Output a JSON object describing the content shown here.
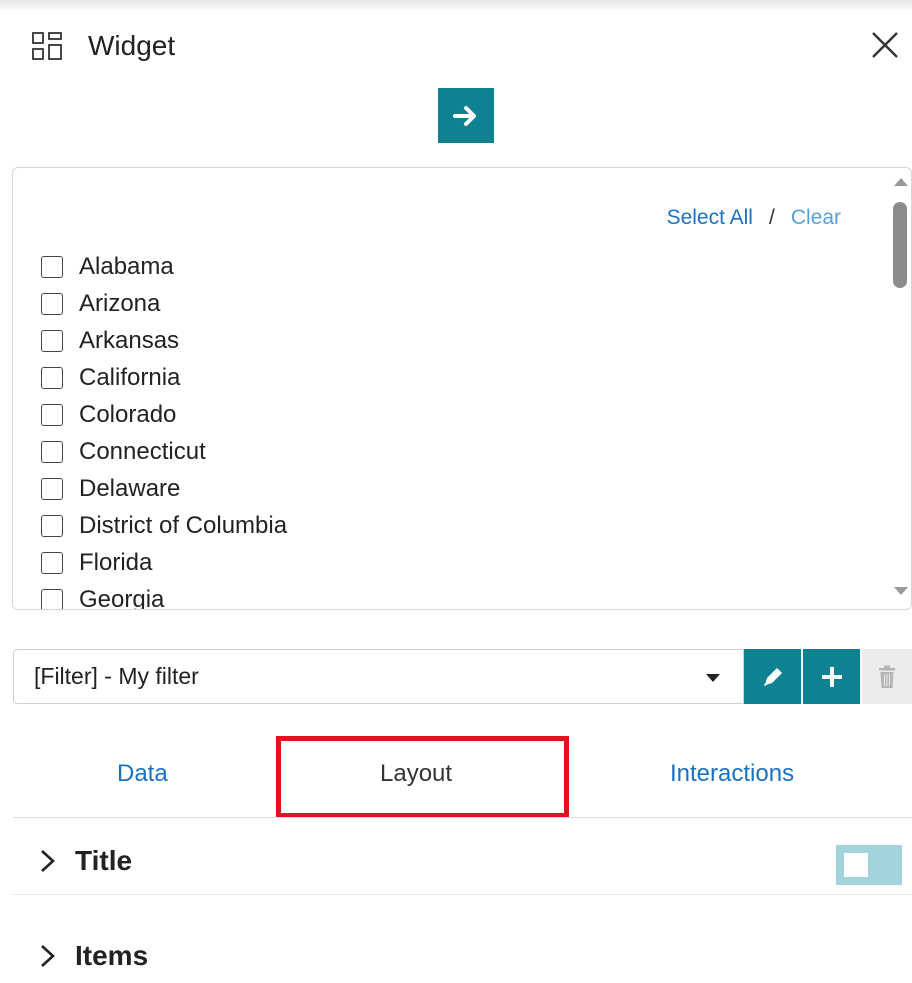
{
  "header": {
    "title": "Widget"
  },
  "list": {
    "select_all": "Select All",
    "separator": "/",
    "clear": "Clear",
    "items": [
      "Alabama",
      "Arizona",
      "Arkansas",
      "California",
      "Colorado",
      "Connecticut",
      "Delaware",
      "District of Columbia",
      "Florida",
      "Georgia"
    ]
  },
  "filter": {
    "selected": "[Filter] - My filter"
  },
  "tabs": [
    {
      "label": "Data"
    },
    {
      "label": "Layout"
    },
    {
      "label": "Interactions"
    }
  ],
  "sections": [
    {
      "label": "Title"
    },
    {
      "label": "Items"
    }
  ],
  "colors": {
    "accent": "#0f8291",
    "link": "#1a72c2",
    "highlight": "#e0141e",
    "toggle_off": "#a3d3db"
  }
}
